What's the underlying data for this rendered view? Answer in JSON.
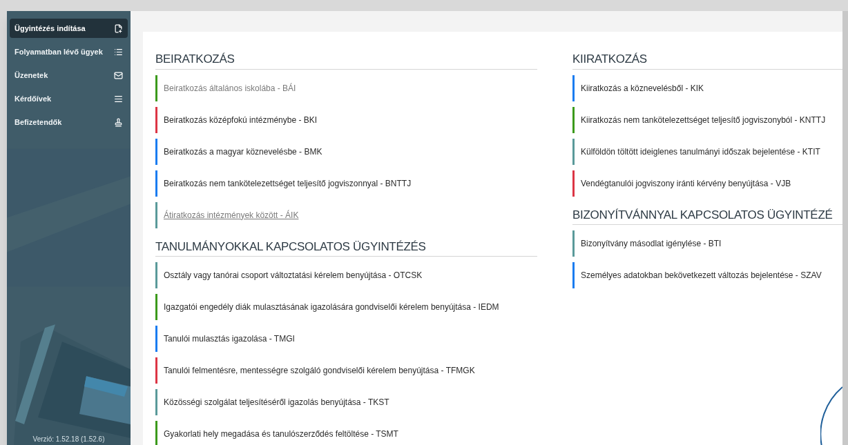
{
  "sidebar": {
    "items": [
      {
        "label": "Ügyintézés indítása",
        "selected": true
      },
      {
        "label": "Folyamatban lévő ügyek",
        "selected": false
      },
      {
        "label": "Üzenetek",
        "selected": false
      },
      {
        "label": "Kérdőívek",
        "selected": false
      },
      {
        "label": "Befizetendők",
        "selected": false
      }
    ],
    "version": "Verzió: 1.52.18 (1.52.6)"
  },
  "columns": [
    {
      "sections": [
        {
          "title": "BEIRATKOZÁS",
          "items": [
            {
              "label": "Beiratkozás általános iskolába - BÁI",
              "color": "#3c9a1c",
              "muted": true,
              "hovered": false
            },
            {
              "label": "Beiratkozás középfokú intézménybe - BKI",
              "color": "#dc3545",
              "muted": false,
              "hovered": false
            },
            {
              "label": "Beiratkozás a magyar köznevelésbe - BMK",
              "color": "#1a7cf0",
              "muted": false,
              "hovered": false
            },
            {
              "label": "Beiratkozás nem tankötelezettséget teljesítő jogviszonnyal - BNTTJ",
              "color": "#1a7cf0",
              "muted": false,
              "hovered": false
            },
            {
              "label": "Átiratkozás intézmények között - ÁIK",
              "color": "#5a9a9a",
              "muted": false,
              "hovered": true
            }
          ]
        },
        {
          "title": "TANULMÁNYOKKAL KAPCSOLATOS ÜGYINTÉZÉS",
          "items": [
            {
              "label": "Osztály vagy tanórai csoport változtatási kérelem benyújtása - OTCSK",
              "color": "#5a9a9a",
              "muted": false,
              "hovered": false
            },
            {
              "label": "Igazgatói engedély diák mulasztásának igazolására gondviselői kérelem benyújtása - IEDM",
              "color": "#3c9a1c",
              "muted": false,
              "hovered": false
            },
            {
              "label": "Tanulói mulasztás igazolása - TMGI",
              "color": "#1a7cf0",
              "muted": false,
              "hovered": false
            },
            {
              "label": "Tanulói felmentésre, mentességre szolgáló gondviselői kérelem benyújtása - TFMGK",
              "color": "#dc3545",
              "muted": false,
              "hovered": false
            },
            {
              "label": "Közösségi szolgálat teljesítéséről igazolás benyújtása - TKST",
              "color": "#5a9a9a",
              "muted": false,
              "hovered": false
            },
            {
              "label": "Gyakorlati hely megadása és tanulószerződés feltöltése - TSMT",
              "color": "#3c9a1c",
              "muted": false,
              "hovered": false
            }
          ]
        }
      ]
    },
    {
      "sections": [
        {
          "title": "KIIRATKOZÁS",
          "items": [
            {
              "label": "Kiiratkozás a köznevelésből - KIK",
              "color": "#1a7cf0",
              "muted": false,
              "hovered": false
            },
            {
              "label": "Kiiratkozás nem tankötelezettséget teljesítő jogviszonyból - KNTTJ",
              "color": "#3c9a1c",
              "muted": false,
              "hovered": false
            },
            {
              "label": "Külföldön töltött ideiglenes tanulmányi időszak bejelentése - KTIT",
              "color": "#5a9a9a",
              "muted": false,
              "hovered": false
            },
            {
              "label": "Vendégtanulói jogviszony iránti kérvény benyújtása - VJB",
              "color": "#dc3545",
              "muted": false,
              "hovered": false
            }
          ]
        },
        {
          "title": "BIZONYÍTVÁNNYAL KAPCSOLATOS ÜGYINTÉZÉ",
          "items": [
            {
              "label": "Bizonyítvány másodlat igénylése - BTI",
              "color": "#5a9a9a",
              "muted": false,
              "hovered": false
            },
            {
              "label": "Személyes adatokban bekövetkezett változás bejelentése - SZAV",
              "color": "#1a7cf0",
              "muted": false,
              "hovered": false
            }
          ]
        }
      ]
    }
  ]
}
